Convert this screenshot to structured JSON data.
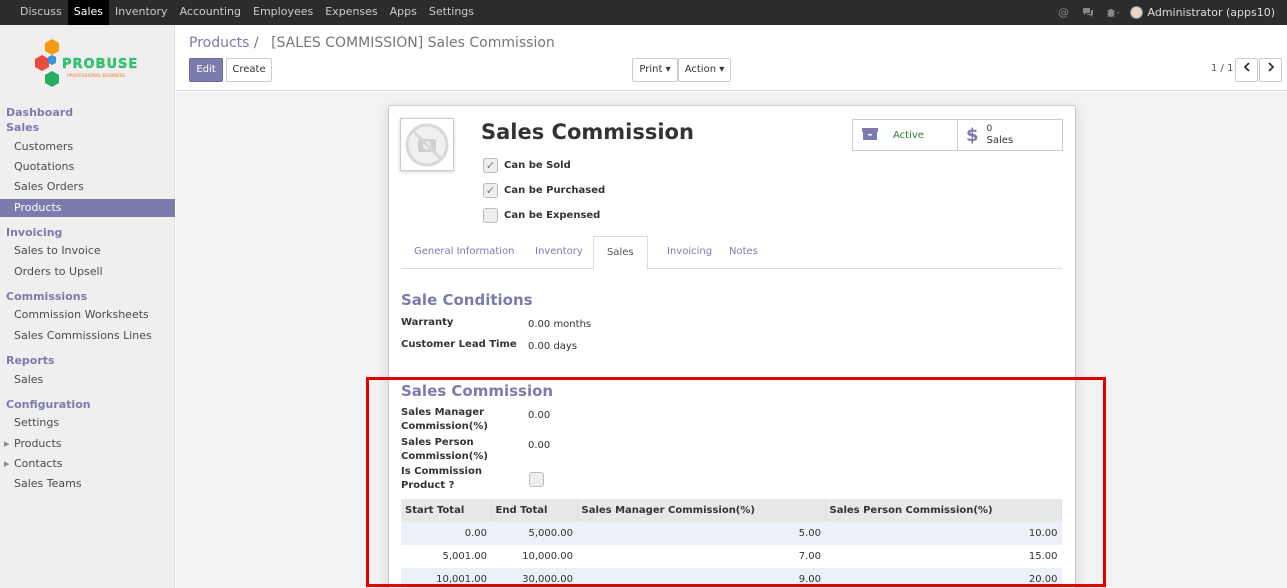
{
  "topnav": {
    "items": [
      "Discuss",
      "Sales",
      "Inventory",
      "Accounting",
      "Employees",
      "Expenses",
      "Apps",
      "Settings"
    ],
    "active": "Sales",
    "icons": [
      "at-icon",
      "chat-icon",
      "bug-icon"
    ],
    "user": "Administrator (apps10)"
  },
  "sidebar": {
    "logo": {
      "brand": "PROBUSE",
      "tagline": "PROFESSIONAL BUSINESS"
    },
    "sections": [
      {
        "title": "Dashboard"
      },
      {
        "title": "Sales",
        "items": [
          "Customers",
          "Quotations",
          "Sales Orders",
          "Products"
        ]
      },
      {
        "title": "Invoicing",
        "items": [
          "Sales to Invoice",
          "Orders to Upsell"
        ]
      },
      {
        "title": "Commissions",
        "items": [
          "Commission Worksheets",
          "Sales Commissions Lines"
        ]
      },
      {
        "title": "Reports",
        "items": [
          "Sales"
        ]
      },
      {
        "title": "Configuration",
        "items": [
          "Settings",
          "Products",
          "Contacts",
          "Sales Teams"
        ]
      }
    ],
    "active_item": "Products"
  },
  "control_panel": {
    "breadcrumb_parent": "Products",
    "breadcrumb_sep": "/",
    "breadcrumb_current": "[SALES COMMISSION] Sales Commission",
    "edit_label": "Edit",
    "create_label": "Create",
    "print_label": "Print",
    "action_label": "Action",
    "pager": "1 / 1"
  },
  "form": {
    "name": "Sales Commission",
    "checkboxes": [
      {
        "label": "Can be Sold",
        "checked": true
      },
      {
        "label": "Can be Purchased",
        "checked": true
      },
      {
        "label": "Can be Expensed",
        "checked": false
      }
    ],
    "active_label": "Active",
    "sales_count": "0",
    "sales_label": "Sales",
    "tabs": [
      "General Information",
      "Inventory",
      "Sales",
      "Invoicing",
      "Notes"
    ],
    "active_tab": "Sales",
    "sale_conditions": {
      "title": "Sale Conditions",
      "warranty_label": "Warranty",
      "warranty_value": "0.00 months",
      "lead_label": "Customer Lead Time",
      "lead_value": "0.00 days"
    },
    "sales_commission": {
      "title": "Sales Commission",
      "manager_label_1": "Sales Manager",
      "manager_label_2": "Commission(%)",
      "manager_value": "0.00",
      "person_label_1": "Sales Person",
      "person_label_2": "Commission(%)",
      "person_value": "0.00",
      "is_comm_label_1": "Is Commission",
      "is_comm_label_2": "Product ?",
      "is_comm_checked": false,
      "table": {
        "headers": [
          "Start Total",
          "End Total",
          "Sales Manager Commission(%)",
          "Sales Person Commission(%)"
        ],
        "rows": [
          [
            "0.00",
            "5,000.00",
            "5.00",
            "10.00"
          ],
          [
            "5,001.00",
            "10,000.00",
            "7.00",
            "15.00"
          ],
          [
            "10,001.00",
            "30,000.00",
            "9.00",
            "20.00"
          ]
        ]
      }
    }
  },
  "colors": {
    "accent": "#7c7bad",
    "highlight": "#e00000",
    "active_green": "#2e7d32"
  }
}
